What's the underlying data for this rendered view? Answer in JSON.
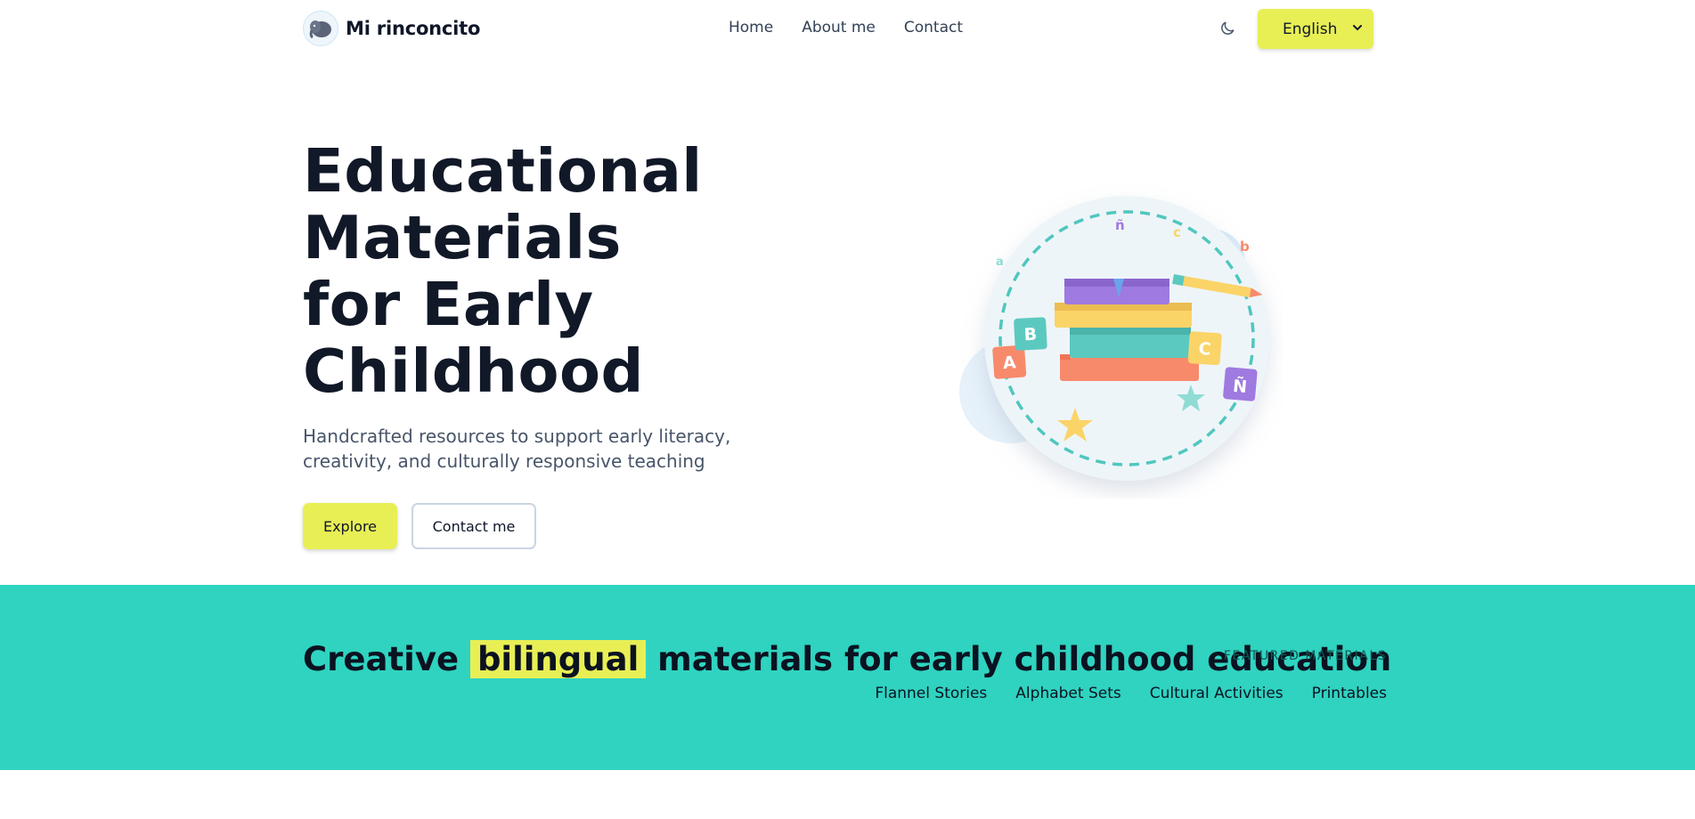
{
  "header": {
    "brand_name": "Mi rinconcito",
    "nav": [
      {
        "label": "Home"
      },
      {
        "label": "About me"
      },
      {
        "label": "Contact"
      }
    ],
    "theme_toggle_icon": "moon-icon",
    "language": {
      "selected": "English",
      "options": [
        "English"
      ]
    }
  },
  "hero": {
    "title_lines": [
      "Educational",
      "Materials",
      "for Early",
      "Childhood"
    ],
    "subtitle": "Handcrafted resources to support early literacy, creativity, and culturally responsive teaching",
    "explore_label": "Explore",
    "contact_label": "Contact me",
    "illustration_letters": [
      "a",
      "ñ",
      "c",
      "b",
      "A",
      "B",
      "C",
      "Ñ"
    ]
  },
  "band": {
    "title_before": "Creative ",
    "title_highlight": "bilingual",
    "title_after": " materials for early childhood education",
    "label": "FEATURED MATERIALS",
    "links": [
      {
        "label": "Flannel Stories"
      },
      {
        "label": "Alphabet Sets"
      },
      {
        "label": "Cultural Activities"
      },
      {
        "label": "Printables"
      }
    ]
  },
  "colors": {
    "accent_yellow": "#e8ef55",
    "teal": "#2fd3c0",
    "text_dark": "#0f172a"
  }
}
